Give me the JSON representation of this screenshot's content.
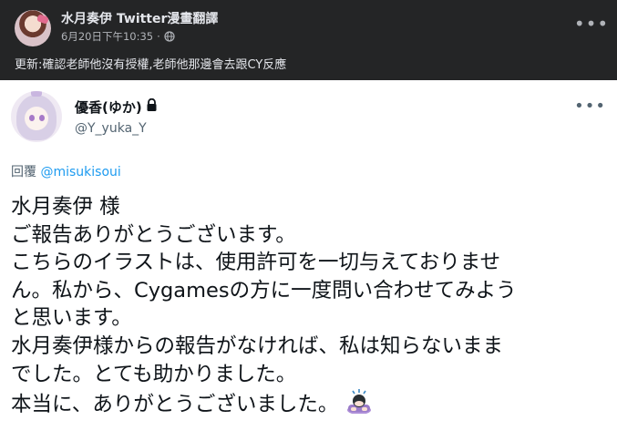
{
  "post": {
    "page_name": "水月奏伊 Twitter漫畫翻譯",
    "timestamp": "6月20日下午10:35",
    "separator": "·",
    "more_icon": "more-horizontal-icon",
    "text": "更新:確認老師他沒有授權,老師他那邊會去跟CY反應"
  },
  "tweet": {
    "display_name": "優香(ゆか)",
    "handle": "@Y_yuka_Y",
    "reply_prefix": "回覆 ",
    "reply_to": "@misukisoui",
    "lines": [
      "水月奏伊 様",
      "ご報告ありがとうございます。",
      "こちらのイラストは、使用許可を一切与えておりませ",
      "ん。私から、Cygamesの方に一度問い合わせてみよう",
      "と思います。",
      "水月奏伊様からの報告がなければ、私は知らないまま",
      "でした。とても助かりました。",
      "本当に、ありがとうございました。"
    ],
    "emoji": "person-bowing-emoji"
  },
  "colors": {
    "fb_background": "#242526",
    "fb_text": "#e4e6eb",
    "fb_secondary": "#b0b3b8",
    "tweet_background": "#ffffff",
    "tweet_text": "#0f1419",
    "tweet_secondary": "#536471",
    "mention": "#1d9bf0"
  }
}
